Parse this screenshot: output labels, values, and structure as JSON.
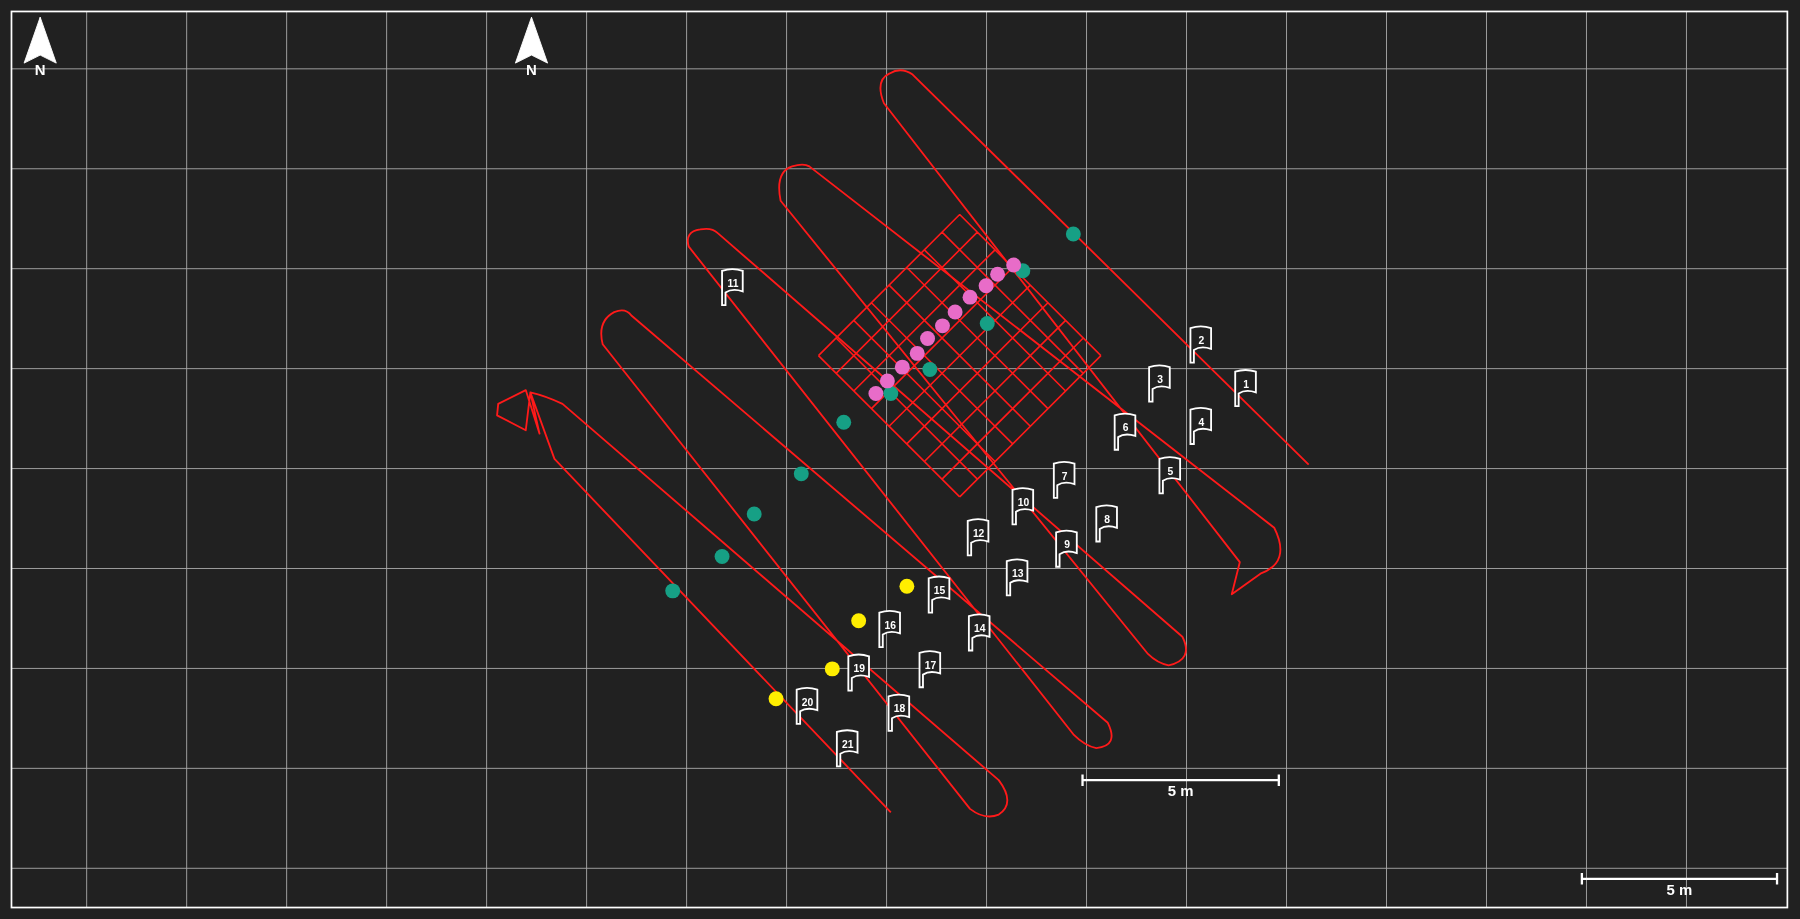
{
  "north_arrows": [
    {
      "label": "N"
    },
    {
      "label": "N"
    }
  ],
  "flags": [
    {
      "label": "1"
    },
    {
      "label": "2"
    },
    {
      "label": "3"
    },
    {
      "label": "4"
    },
    {
      "label": "5"
    },
    {
      "label": "6"
    },
    {
      "label": "7"
    },
    {
      "label": "8"
    },
    {
      "label": "9"
    },
    {
      "label": "10"
    },
    {
      "label": "11"
    },
    {
      "label": "12"
    },
    {
      "label": "13"
    },
    {
      "label": "14"
    },
    {
      "label": "15"
    },
    {
      "label": "16"
    },
    {
      "label": "17"
    },
    {
      "label": "18"
    },
    {
      "label": "19"
    },
    {
      "label": "20"
    },
    {
      "label": "21"
    }
  ],
  "markers": [
    {
      "color": "#16a085"
    },
    {
      "color": "#16a085"
    },
    {
      "color": "#16a085"
    },
    {
      "color": "#16a085"
    },
    {
      "color": "#16a085"
    },
    {
      "color": "#16a085"
    },
    {
      "color": "#16a085"
    },
    {
      "color": "#16a085"
    },
    {
      "color": "#16a085"
    },
    {
      "color": "#16a085"
    },
    {
      "color": "#e86cc8"
    },
    {
      "color": "#e86cc8"
    },
    {
      "color": "#e86cc8"
    },
    {
      "color": "#e86cc8"
    },
    {
      "color": "#e86cc8"
    },
    {
      "color": "#e86cc8"
    },
    {
      "color": "#e86cc8"
    },
    {
      "color": "#e86cc8"
    },
    {
      "color": "#e86cc8"
    },
    {
      "color": "#e86cc8"
    },
    {
      "color": "#e86cc8"
    },
    {
      "color": "#ffee00"
    },
    {
      "color": "#ffee00"
    },
    {
      "color": "#ffee00"
    },
    {
      "color": "#ffee00"
    }
  ],
  "scale_bars": [
    {
      "label": "5 m"
    },
    {
      "label": "5 m"
    }
  ]
}
